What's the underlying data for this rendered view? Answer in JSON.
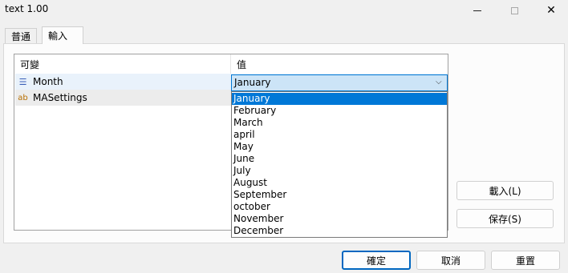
{
  "window": {
    "title": "text 1.00",
    "minimize_icon": "minimize-icon",
    "maximize_icon": "maximize-icon",
    "close_icon": "close-icon",
    "close_glyph": "✕"
  },
  "tabs": [
    {
      "label": "普通",
      "active": false
    },
    {
      "label": "輸入",
      "active": true
    }
  ],
  "grid": {
    "headers": {
      "variable": "可變",
      "value": "值"
    },
    "rows": [
      {
        "icon": "enum-icon",
        "icon_glyph": "☰",
        "name": "Month",
        "value": "January"
      },
      {
        "icon": "string-icon",
        "icon_glyph": "ab",
        "name": "MASettings",
        "value": ""
      }
    ]
  },
  "combo": {
    "selected": "January",
    "arrow_glyph": "⌵",
    "options": [
      "January",
      "February",
      "March",
      "april",
      "May",
      "June",
      "July",
      "August",
      "September",
      "october",
      "November",
      "December"
    ],
    "selected_index": 0
  },
  "side_buttons": {
    "load": "載入(L)",
    "save": "保存(S)"
  },
  "footer_buttons": {
    "ok": "確定",
    "cancel": "取消",
    "reset": "重置"
  },
  "colors": {
    "selection": "#0078d7",
    "focus_border": "#0078d4",
    "combo_bg": "#cce4f7"
  }
}
